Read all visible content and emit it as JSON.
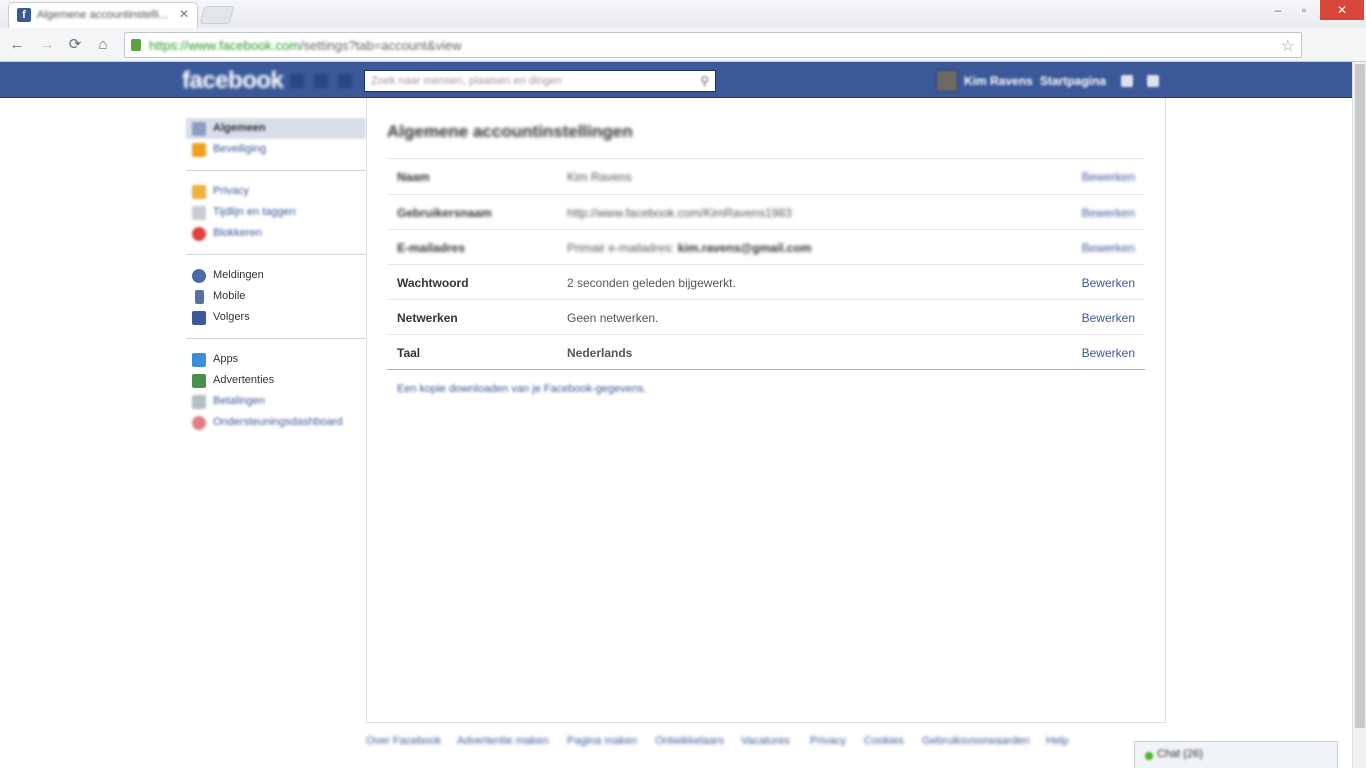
{
  "browser": {
    "tab_title": "Algemene accountinstelli...",
    "tab_favicon": "f",
    "url_scheme": "https://",
    "url_host": "www.facebook.com",
    "url_path": "/settings?tab=account&view"
  },
  "fb_header": {
    "logo": "facebook",
    "search_placeholder": "Zoek naar mensen, plaatsen en dingen",
    "user_name": "Kim Ravens",
    "home_label": "Startpagina"
  },
  "leftnav": {
    "group1": [
      {
        "label": "Algemeen",
        "icon": "wrench-icon",
        "color": "#8b9dc3"
      },
      {
        "label": "Beveiliging",
        "icon": "shield-icon",
        "color": "#f0a020"
      }
    ],
    "group2": [
      {
        "label": "Privacy",
        "icon": "lock-icon",
        "color": "#f0b040"
      },
      {
        "label": "Tijdlijn en taggen",
        "icon": "calendar-icon",
        "color": "#c8ccd4"
      },
      {
        "label": "Blokkeren",
        "icon": "block-icon",
        "color": "#e04040"
      }
    ],
    "group3": [
      {
        "label": "Meldingen",
        "icon": "globe-icon",
        "color": "#4a6aa8"
      },
      {
        "label": "Mobile",
        "icon": "phone-icon",
        "color": "#5870a0"
      },
      {
        "label": "Volgers",
        "icon": "rss-icon",
        "color": "#3b5998"
      }
    ],
    "group4": [
      {
        "label": "Apps",
        "icon": "cube-icon",
        "color": "#3a8fd8"
      },
      {
        "label": "Advertenties",
        "icon": "ads-icon",
        "color": "#4a8f4a"
      },
      {
        "label": "Betalingen",
        "icon": "card-icon",
        "color": "#b8bcc4"
      },
      {
        "label": "Ondersteuningsdashboard",
        "icon": "lifebuoy-icon",
        "color": "#e08080"
      }
    ]
  },
  "main": {
    "title": "Algemene accountinstellingen",
    "rows": [
      {
        "label": "Naam",
        "value": "Kim Ravens",
        "edit": "Bewerken"
      },
      {
        "label": "Gebruikersnaam",
        "value": "http://www.facebook.com/KimRavens1983",
        "edit": "Bewerken"
      },
      {
        "label": "E-mailadres",
        "value_prefix": "Primair e-mailadres:",
        "value_bold": "kim.ravens@gmail.com",
        "edit": "Bewerken"
      },
      {
        "label": "Wachtwoord",
        "value": "2 seconden geleden bijgewerkt.",
        "edit": "Bewerken"
      },
      {
        "label": "Netwerken",
        "value": "Geen netwerken.",
        "edit": "Bewerken"
      },
      {
        "label": "Taal",
        "value_bold": "Nederlands",
        "edit": "Bewerken"
      }
    ],
    "download_link": "Een kopie downloaden van je Facebook-gegevens."
  },
  "footer": {
    "links": [
      "Over Facebook",
      "Advertentie maken",
      "Pagina maken",
      "Ontwikkelaars",
      "Vacatures",
      "Privacy",
      "Cookies",
      "Gebruiksvoorwaarden",
      "Help"
    ]
  },
  "chat": {
    "label": "Chat (26)"
  }
}
